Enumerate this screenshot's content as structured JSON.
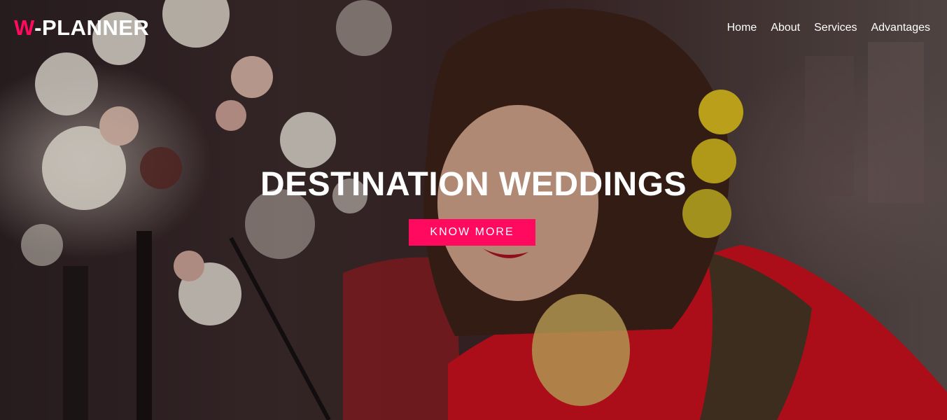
{
  "brand": {
    "accent_letter": "W",
    "rest": "-PLANNER",
    "accent_color": "#ff0a5e"
  },
  "nav": {
    "items": [
      {
        "label": "Home"
      },
      {
        "label": "About"
      },
      {
        "label": "Services"
      },
      {
        "label": "Advantages"
      }
    ]
  },
  "hero": {
    "title": "DESTINATION WEDDINGS",
    "cta_label": "KNOW MORE",
    "cta_color": "#ff0a5e"
  }
}
